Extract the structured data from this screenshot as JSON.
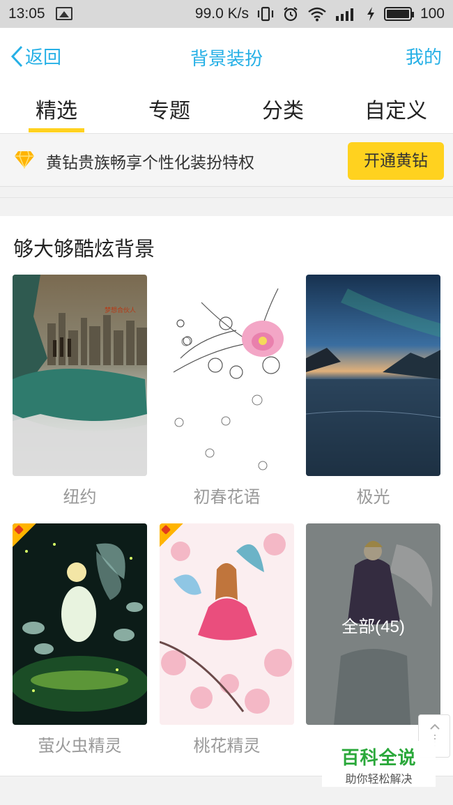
{
  "status_bar": {
    "time": "13:05",
    "network_speed": "99.0 K/s",
    "battery": "100",
    "icons": [
      "picture-icon",
      "vibrate-icon",
      "alarm-icon",
      "wifi-icon",
      "signal-icon",
      "charging-icon",
      "battery-icon"
    ]
  },
  "navbar": {
    "back_label": "返回",
    "title": "背景装扮",
    "mine_label": "我的",
    "accent_color": "#26b0e6"
  },
  "tabs": [
    {
      "label": "精选",
      "selected": true
    },
    {
      "label": "专题",
      "selected": false
    },
    {
      "label": "分类",
      "selected": false
    },
    {
      "label": "自定义",
      "selected": false
    }
  ],
  "vip_banner": {
    "text": "黄钻贵族畅享个性化装扮特权",
    "button_label": "开通黄钻",
    "button_color": "#ffd21f",
    "icon": "diamond-icon"
  },
  "section": {
    "title": "够大够酷炫背景",
    "items": [
      {
        "caption": "纽约",
        "badge": false
      },
      {
        "caption": "初春花语",
        "badge": false
      },
      {
        "caption": "极光",
        "badge": false
      },
      {
        "caption": "萤火虫精灵",
        "badge": true
      },
      {
        "caption": "桃花精灵",
        "badge": true
      },
      {
        "caption": "",
        "badge": false,
        "overlay_label": "全部(45)"
      }
    ]
  },
  "watermark": {
    "line1": "百科全说",
    "line2": "助你轻松解决"
  }
}
